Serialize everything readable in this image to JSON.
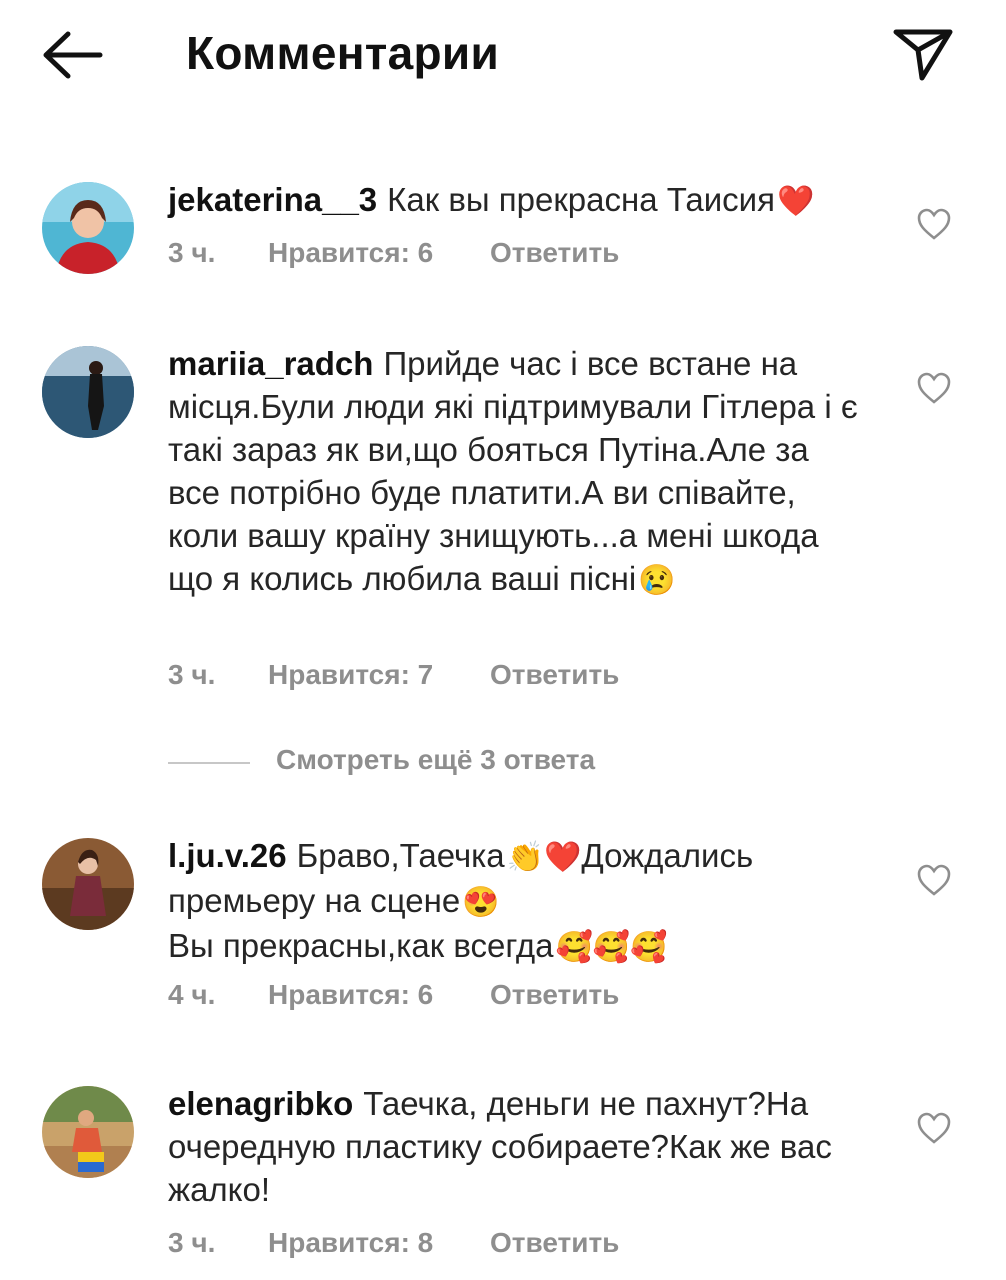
{
  "header": {
    "title": "Комментарии",
    "back_icon": "arrow-left-icon",
    "send_icon": "paper-plane-icon"
  },
  "comments": [
    {
      "username": "jekaterina__3",
      "text": "Как вы прекрасна Таисия",
      "emoji": "❤️",
      "time": "3 ч.",
      "likes": "Нравится: 6",
      "reply": "Ответить"
    },
    {
      "username": "mariia_radch",
      "text": "Прийде час і все встане на місця.Були люди які підтримували Гітлера і є такі зараз  як ви,що бояться Путіна.Але за все потрібно буде платити.А ви співайте, коли вашу країну знищують...а мені шкода що я колись любила ваші пісні",
      "emoji": "😢",
      "time": "3 ч.",
      "likes": "Нравится: 7",
      "reply": "Ответить"
    },
    {
      "username": "l.ju.v.26",
      "text_line1": "Браво,Таечка",
      "emoji1": "👏❤️",
      "text_line1b": "Дождались премьеру на сцене",
      "emoji2": "😍",
      "text_line2": "Вы прекрасны,как всегда",
      "emoji3": "🥰🥰🥰",
      "time": "4 ч.",
      "likes": "Нравится: 6",
      "reply": "Ответить"
    },
    {
      "username": "elenagribko",
      "text": "Таечка, деньги не пахнут?На очередную пластику собираете?Как же вас жалко!",
      "time": "3 ч.",
      "likes": "Нравится: 8",
      "reply": "Ответить"
    }
  ],
  "view_more_replies": "Смотреть ещё 3 ответа",
  "colors": {
    "text": "#262626",
    "secondary": "#8e8e8e",
    "divider": "#c7c7c7",
    "heart_outline": "#8e8e8e"
  }
}
